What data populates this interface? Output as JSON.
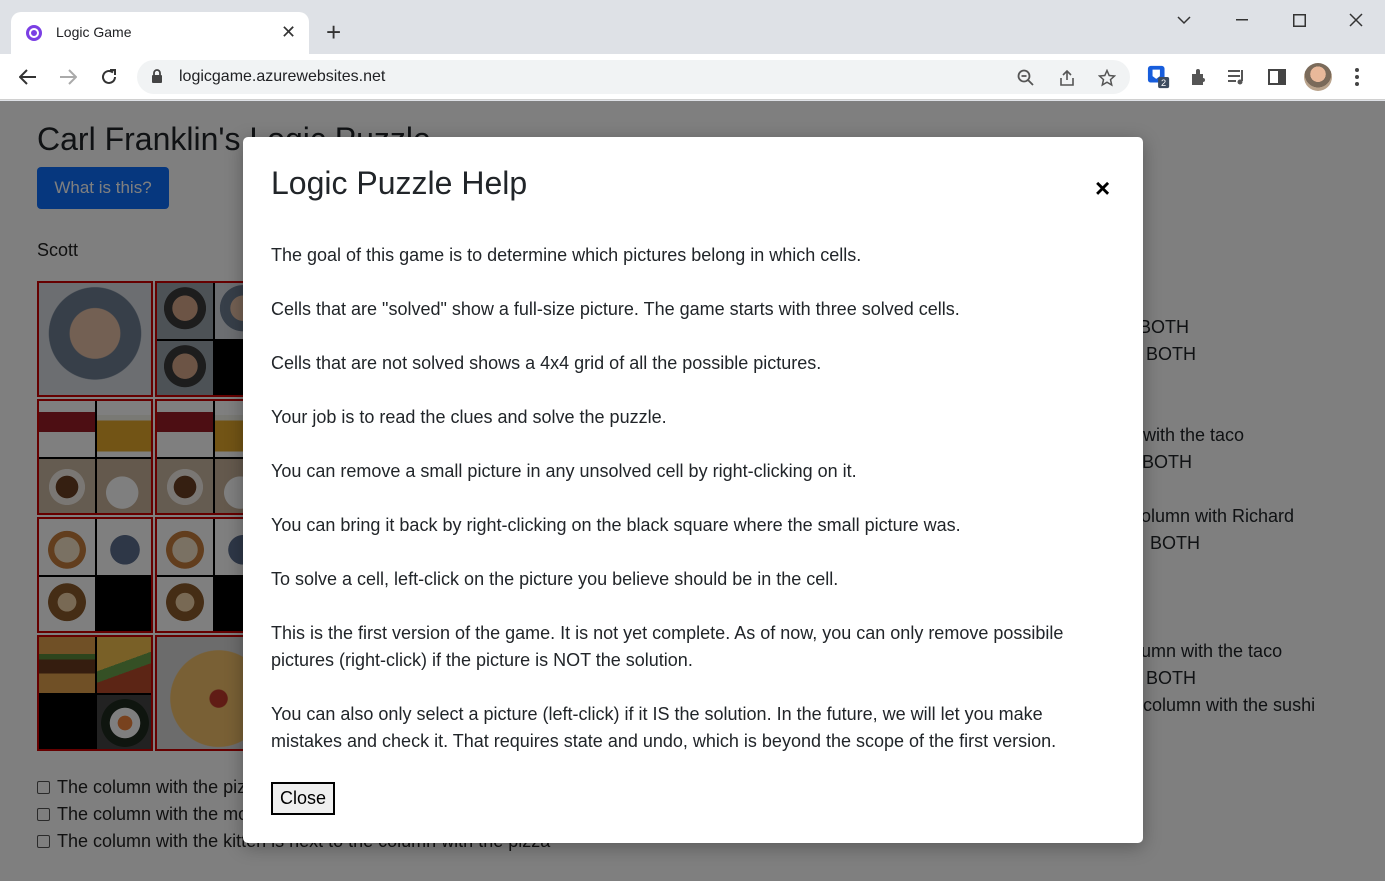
{
  "browser": {
    "tab_title": "Logic Game",
    "url": "logicgame.azurewebsites.net",
    "extension_badge": "2"
  },
  "page": {
    "title": "Carl Franklin's Logic Puzzle",
    "what_button": "What is this?",
    "player_name": "Scott",
    "right_clues": [
      "BOTH",
      "BOTH",
      "with the taco",
      "BOTH",
      "olumn with Richard",
      "BOTH",
      "umn with the taco",
      "BOTH",
      "column with the sushi"
    ],
    "checkbox_clues": [
      "The column with the piz",
      "The column with the mo",
      "The column with the kitten is next to the column with the pizza"
    ]
  },
  "modal": {
    "title": "Logic Puzzle Help",
    "close_x": "×",
    "paragraphs": [
      "The goal of this game is to determine which pictures belong in which cells.",
      "Cells that are \"solved\" show a full-size picture. The game starts with three solved cells.",
      "Cells that are not solved shows a 4x4 grid of all the possible pictures.",
      "Your job is to read the clues and solve the puzzle.",
      "You can remove a small picture in any unsolved cell by right-clicking on it.",
      "You can bring it back by right-clicking on the black square where the small picture was.",
      "To solve a cell, left-click on the picture you believe should be in the cell.",
      "This is the first version of the game. It is not yet complete. As of now, you can only remove possibile pictures (right-click) if the picture is NOT the solution.",
      "You can also only select a picture (left-click) if it IS the solution. In the future, we will let you make mistakes and check it. That requires state and undo, which is beyond the scope of the first version."
    ],
    "close_button": "Close"
  },
  "colors": {
    "primary_button": "#0d6efd",
    "cell_border": "#cc0000",
    "overlay": "rgba(0,0,0,0.5)"
  }
}
